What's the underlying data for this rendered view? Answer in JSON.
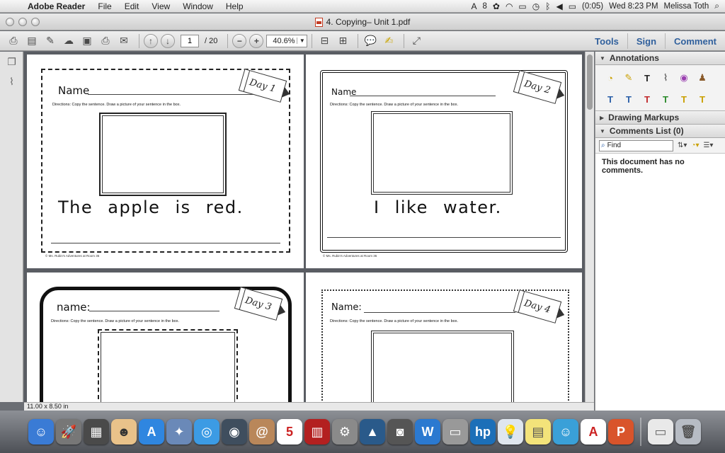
{
  "menubar": {
    "app_name": "Adobe Reader",
    "items": [
      "File",
      "Edit",
      "View",
      "Window",
      "Help"
    ],
    "status": {
      "battery_number": "8",
      "battery": "(0:05)",
      "clock": "Wed 8:23 PM",
      "user": "Melissa Toth"
    }
  },
  "window": {
    "title": "4.  Copying– Unit 1.pdf"
  },
  "toolbar": {
    "page_current": "1",
    "page_total": "/  20",
    "zoom": "40.6%",
    "links": {
      "tools": "Tools",
      "sign": "Sign",
      "comment": "Comment"
    }
  },
  "pages": [
    {
      "name_label": "Name",
      "day": "Day 1",
      "directions": "Directions: Copy the sentence.  Draw a picture of your sentence in the box.",
      "sentence": "The apple is red.",
      "footer": "© Ms. Rubin's Adventures at Room 36"
    },
    {
      "name_label": "Name",
      "day": "Day 2",
      "directions": "Directions: Copy the sentence.  Draw a picture of your sentence in the box.",
      "sentence": "I like water.",
      "footer": "© Ms. Rubin's Adventures at Room 36"
    },
    {
      "name_label": "name:",
      "day": "Day 3",
      "directions": "Directions: Copy the sentence.  Draw a picture of your sentence in the box.",
      "sentence": "",
      "footer": ""
    },
    {
      "name_label": "Name:",
      "day": "Day 4",
      "directions": "Directions: Copy the sentence.  Draw a picture of your sentence in the box.",
      "sentence": "",
      "footer": ""
    }
  ],
  "statusbar": {
    "page_size": "11.00 x 8.50 in"
  },
  "right_panel": {
    "annotations_title": "Annotations",
    "drawing_title": "Drawing Markups",
    "comments_title": "Comments List (0)",
    "find_placeholder": "Find",
    "no_comments": "This document has no comments."
  },
  "colors": {
    "link_blue": "#2f5f9c",
    "dock_bg": "#5f6268"
  }
}
